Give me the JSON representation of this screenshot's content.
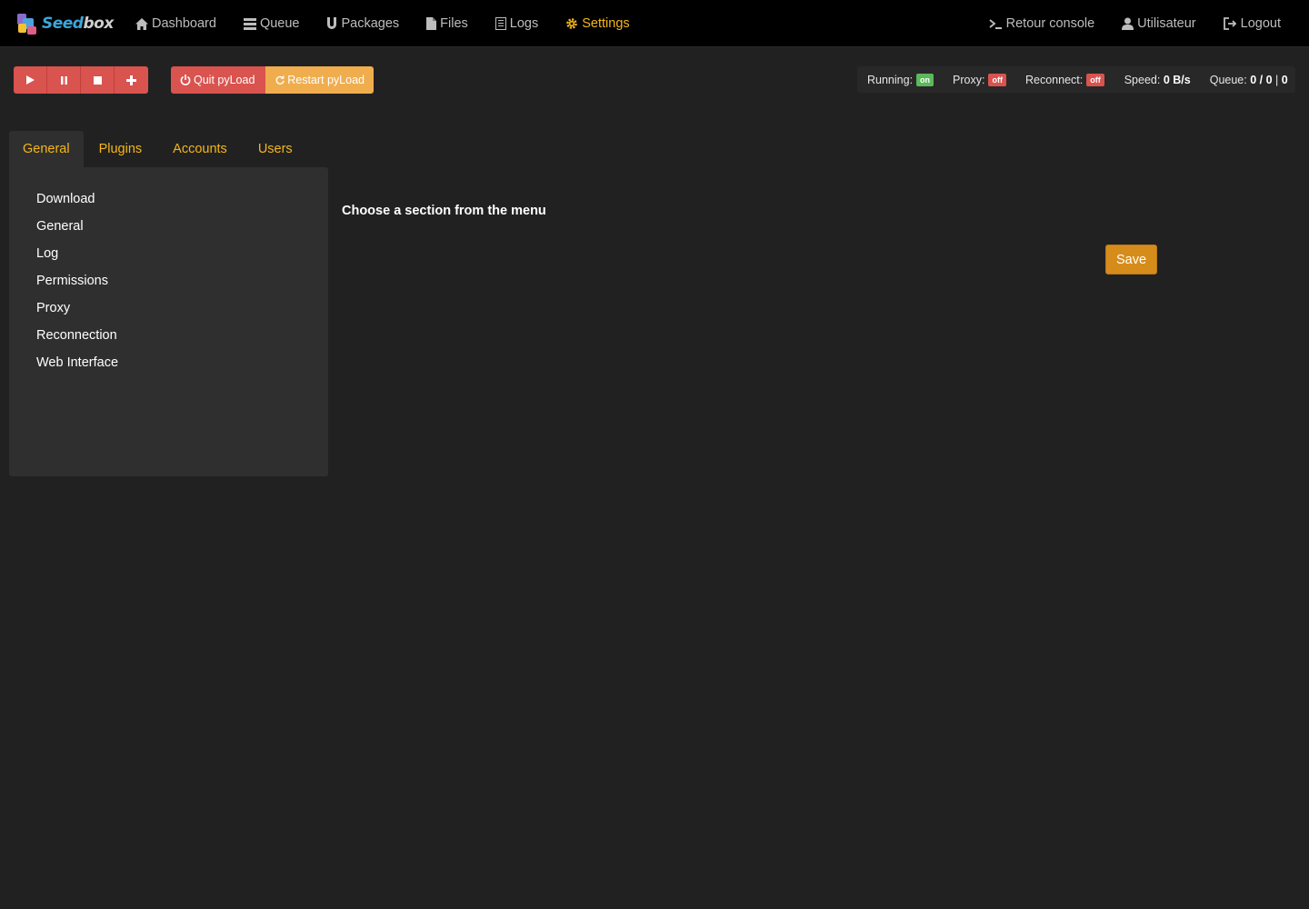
{
  "brand": {
    "logo_text_a": "Seed",
    "logo_text_b": "box"
  },
  "nav": {
    "left": [
      {
        "label": "Dashboard",
        "icon": "home-icon"
      },
      {
        "label": "Queue",
        "icon": "queue-icon"
      },
      {
        "label": "Packages",
        "icon": "magnet-icon"
      },
      {
        "label": "Files",
        "icon": "file-icon"
      },
      {
        "label": "Logs",
        "icon": "list-icon"
      },
      {
        "label": "Settings",
        "icon": "gear-icon",
        "active": true
      }
    ],
    "right": [
      {
        "label": "Retour console",
        "icon": "console-icon"
      },
      {
        "label": "Utilisateur",
        "icon": "user-icon"
      },
      {
        "label": "Logout",
        "icon": "logout-icon"
      }
    ]
  },
  "toolbar": {
    "controls": [
      "play-icon",
      "pause-icon",
      "stop-icon",
      "plus-icon"
    ],
    "quit_label": "Quit pyLoad",
    "restart_label": "Restart pyLoad"
  },
  "status": {
    "running_label": "Running:",
    "running_value": "on",
    "proxy_label": "Proxy:",
    "proxy_value": "off",
    "reconnect_label": "Reconnect:",
    "reconnect_value": "off",
    "speed_label": "Speed:",
    "speed_value": "0 B/s",
    "queue_label": "Queue:",
    "queue_value": "0 / 0",
    "queue_sep": "|",
    "queue_total": "0"
  },
  "tabs": [
    {
      "label": "General",
      "active": true
    },
    {
      "label": "Plugins"
    },
    {
      "label": "Accounts"
    },
    {
      "label": "Users"
    }
  ],
  "sections": [
    "Download",
    "General",
    "Log",
    "Permissions",
    "Proxy",
    "Reconnection",
    "Web Interface"
  ],
  "main": {
    "hint": "Choose a section from the menu",
    "save_label": "Save"
  },
  "colors": {
    "accent": "#f5b61a",
    "danger": "#d9534f",
    "warning": "#f0ad4e",
    "success": "#5cb85c",
    "save": "#d68c1b"
  }
}
